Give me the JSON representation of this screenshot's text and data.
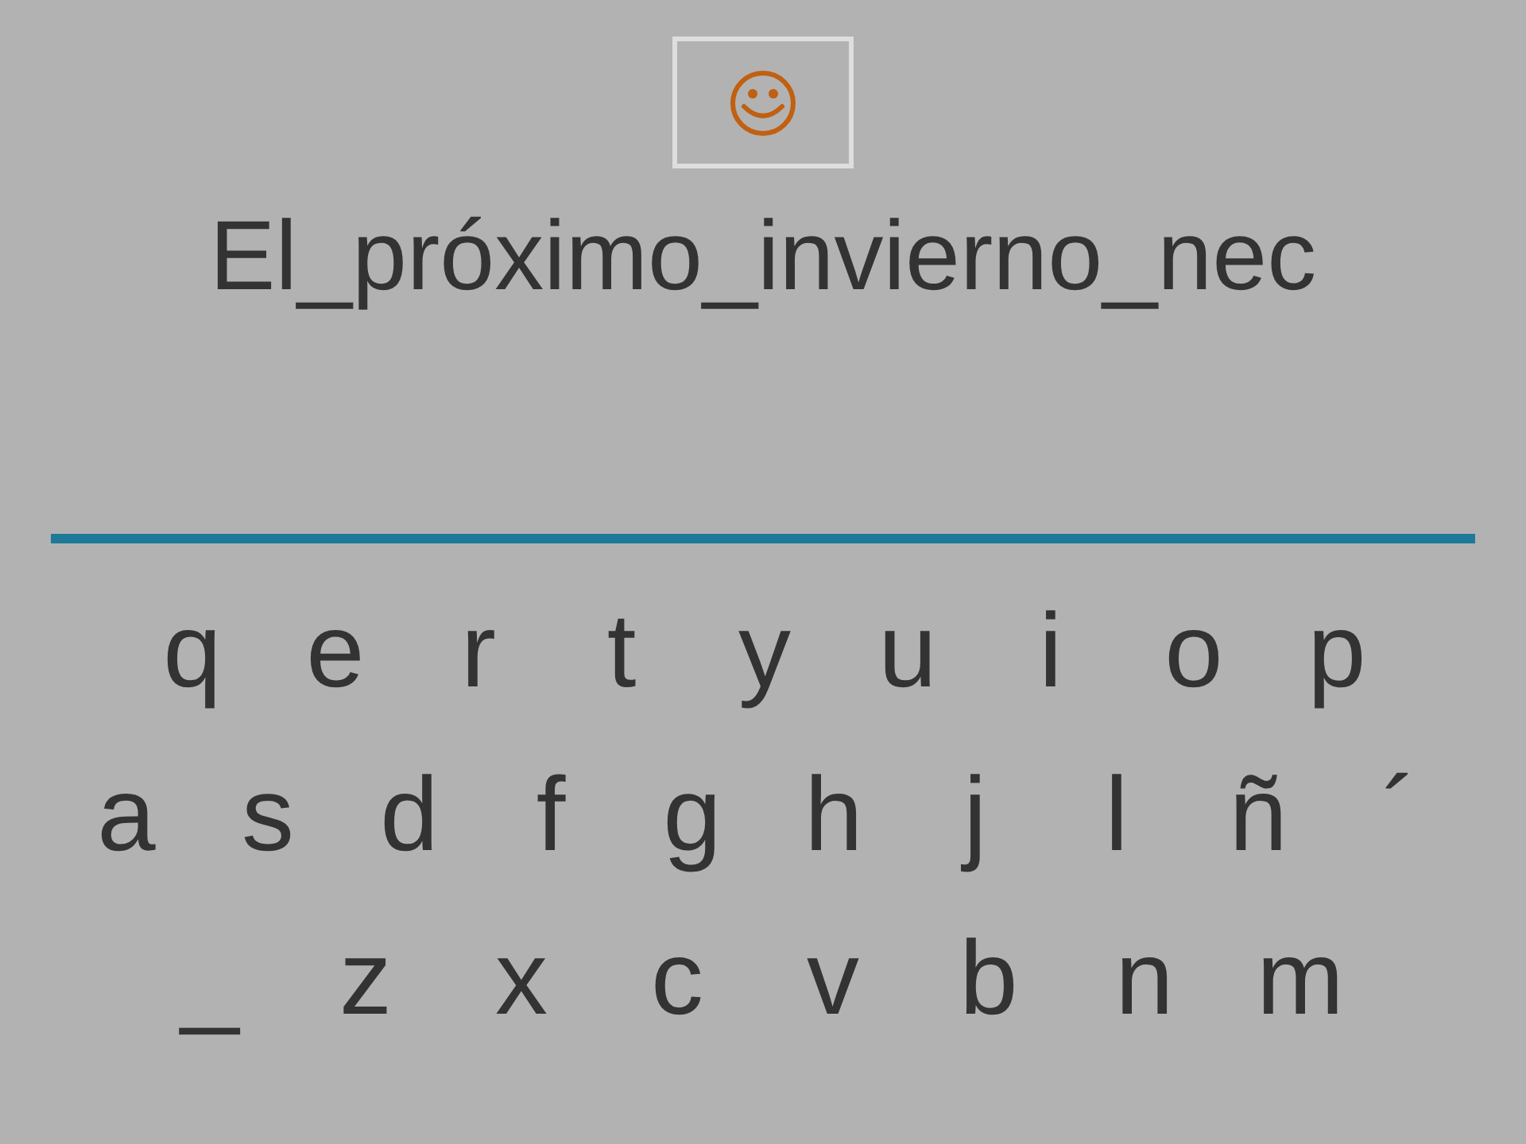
{
  "phrase": "El_próximo_invierno_nec",
  "keyboard": {
    "rows": [
      [
        "q",
        "e",
        "r",
        "t",
        "y",
        "u",
        "i",
        "o",
        "p"
      ],
      [
        "a",
        "s",
        "d",
        "f",
        "g",
        "h",
        "j",
        "l",
        "ñ",
        "´"
      ],
      [
        "_",
        "z",
        "x",
        "c",
        "v",
        "b",
        "n",
        "m"
      ]
    ]
  }
}
